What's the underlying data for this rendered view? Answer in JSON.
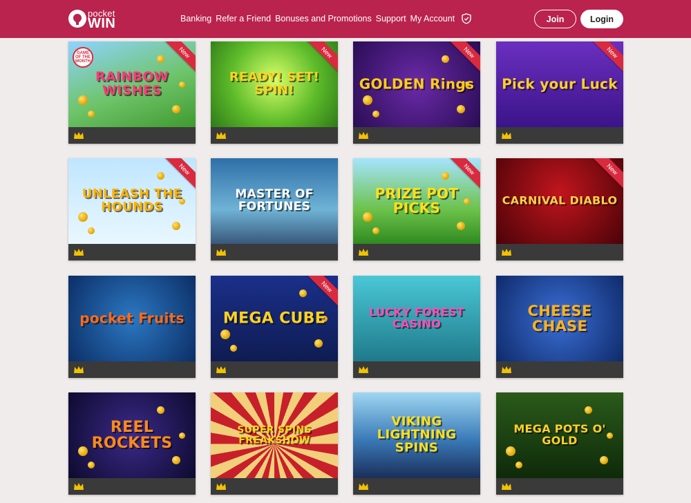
{
  "brand": {
    "top": "pocket",
    "bottom": "WIN"
  },
  "nav": [
    {
      "label": "Banking"
    },
    {
      "label": "Refer a Friend"
    },
    {
      "label": "Bonuses and Promotions"
    },
    {
      "label": "Support"
    },
    {
      "label": "My Account"
    }
  ],
  "buttons": {
    "join": "Join",
    "login": "Login"
  },
  "colors": {
    "header": "#b9234d",
    "background": "#efeceb",
    "card_bar": "#3a3a3a",
    "ribbon": "#d92a3f",
    "crown": "#f2c200"
  },
  "new_label": "New",
  "game_of_month_label": "GAME OF THE MONTH",
  "games": [
    {
      "title": "RAINBOW WISHES",
      "new": true,
      "game_of_month": true
    },
    {
      "title": "READY! SET! SPIN!",
      "new": true
    },
    {
      "title": "GOLDEN Rings",
      "new": true
    },
    {
      "title": "Pick your Luck",
      "new": true
    },
    {
      "title": "UNLEASH THE HOUNDS",
      "new": true
    },
    {
      "title": "MASTER OF FORTUNES",
      "new": false
    },
    {
      "title": "PRIZE POT PICKS",
      "new": true
    },
    {
      "title": "CARNIVAL DIABLO",
      "new": true
    },
    {
      "title": "pocket Fruits",
      "new": false
    },
    {
      "title": "MEGA CUBE",
      "new": true
    },
    {
      "title": "LUCKY FOREST CASINO",
      "new": false
    },
    {
      "title": "CHEESE CHASE",
      "new": false
    },
    {
      "title": "REEL ROCKETS",
      "new": false
    },
    {
      "title": "SUPER SPINS FREAKSHOW",
      "new": false
    },
    {
      "title": "VIKING LIGHTNING SPINS",
      "new": false
    },
    {
      "title": "MEGA POTS O' GOLD",
      "new": false
    }
  ]
}
